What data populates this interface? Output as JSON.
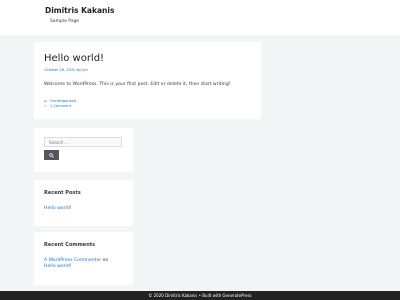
{
  "header": {
    "site_title": "Dimitris Kakanis",
    "nav": [
      {
        "label": "Sample Page"
      }
    ]
  },
  "post": {
    "title": "Hello world!",
    "date": "October 28, 2020",
    "by": "by",
    "author": "jim",
    "content": "Welcome to WordPress. This is your first post. Edit or delete it, then start writing!",
    "category": "Uncategorized",
    "comments": "1 Comment"
  },
  "search": {
    "placeholder": "Search …",
    "icon": "search-icon"
  },
  "recent_posts": {
    "title": "Recent Posts",
    "items": [
      {
        "label": "Hello world!"
      }
    ]
  },
  "recent_comments": {
    "title": "Recent Comments",
    "commenter": "A WordPress Commenter",
    "on": "on",
    "post": "Hello world!"
  },
  "footer": {
    "copyright": "© 2020 Dimitris Kakanis • Built with",
    "builder": "GeneratePress"
  },
  "colors": {
    "background": "#f4f5f6",
    "link": "#1e73be",
    "button": "#55555e",
    "footer": "#222222"
  }
}
